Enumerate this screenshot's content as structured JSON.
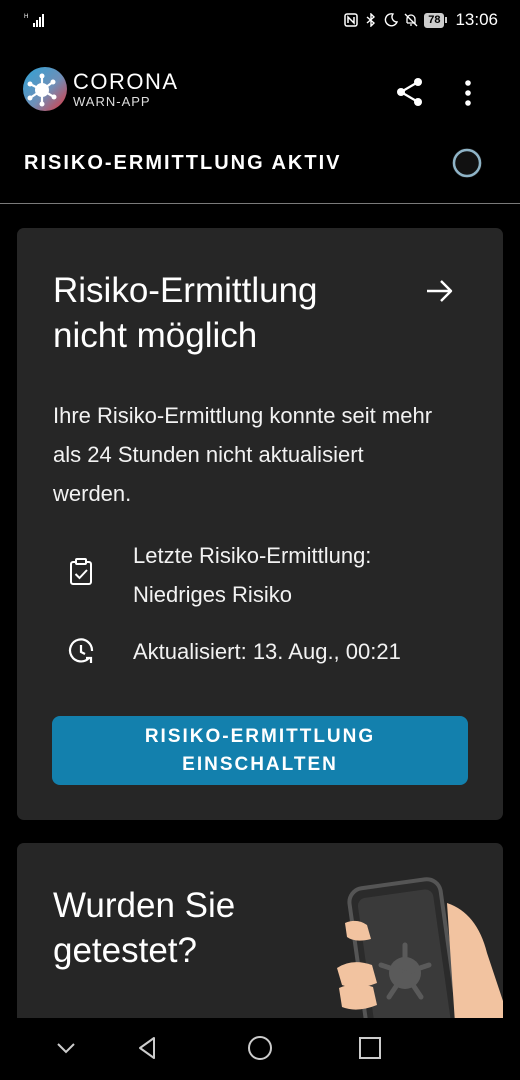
{
  "status_bar": {
    "time": "13:06",
    "battery": "78",
    "icons": [
      "signal-icon",
      "nfc-icon",
      "bluetooth-icon",
      "moon-icon",
      "mute-icon",
      "battery-icon"
    ]
  },
  "app_bar": {
    "title": "CORONA",
    "subtitle": "WARN-APP",
    "share_icon": "share-icon",
    "more_icon": "more-vert-icon"
  },
  "risk_status": {
    "label": "RISIKO-ERMITTLUNG AKTIV",
    "indicator": "spinner-icon"
  },
  "risk_card": {
    "title": "Risiko-Ermittlung nicht möglich",
    "body": "Ihre Risiko-Ermittlung konnte seit mehr als 24 Stunden nicht aktualisiert werden.",
    "last_label": "Letzte Risiko-Ermittlung:",
    "last_value": "Niedriges Risiko",
    "updated": "Aktualisiert: 13. Aug., 00:21",
    "button_label": "RISIKO-ERMITTLUNG EINSCHALTEN"
  },
  "test_card": {
    "title": "Wurden Sie getestet?"
  },
  "colors": {
    "background": "#000000",
    "card": "#262626",
    "button": "#1380ad",
    "spinner": "#8fb4c7"
  }
}
